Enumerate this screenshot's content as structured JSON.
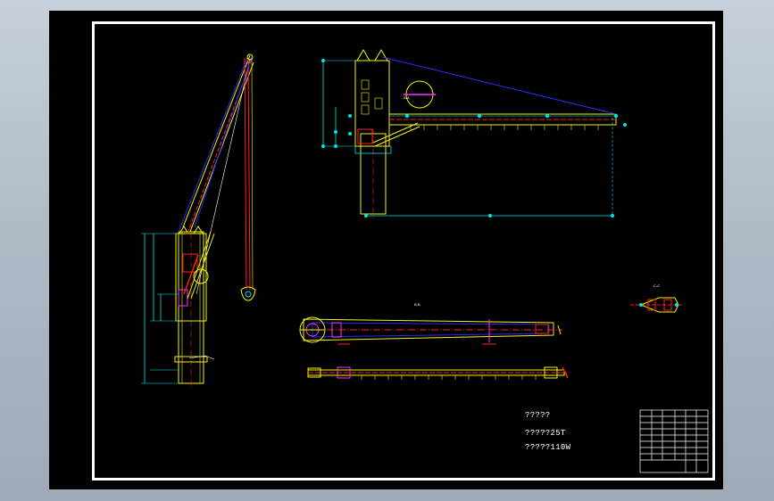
{
  "notes": {
    "line1": "?????",
    "line2": "?????25T",
    "line3": "?????110W"
  },
  "labels": {
    "section_aa": "A-A",
    "section_bb": "B-B",
    "section_cc": "C-C"
  },
  "colors": {
    "workspace_bg": "#b4bfcb",
    "sheet_bg": "#000000",
    "frame": "#ffffff",
    "yellow": "#f5f500",
    "cyan": "#00e5e5",
    "red": "#ff2020",
    "blue": "#2a2aff",
    "magenta": "#ff30ff"
  }
}
